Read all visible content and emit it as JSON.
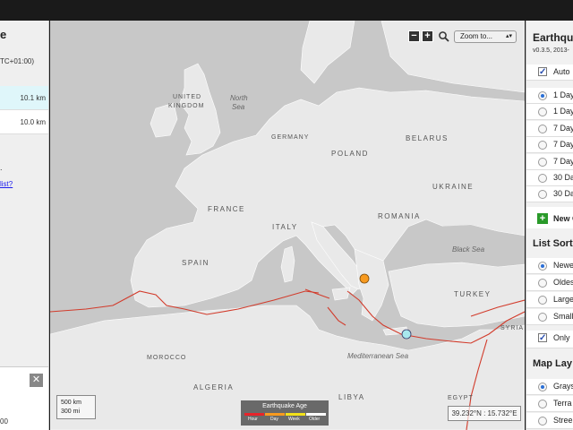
{
  "left_panel": {
    "title": "e",
    "utc": "TC+01:00)",
    "rows": [
      {
        "depth": "10.1 km"
      },
      {
        "depth": "10.0 km"
      }
    ],
    "dot": ".",
    "link": "list?",
    "close_icon": "close-icon",
    "bottom_value": "00"
  },
  "map": {
    "labels": {
      "uk": "UNITED",
      "kingdom": "KINGDOM",
      "north_sea": "North",
      "north_sea2": "Sea",
      "germany": "GERMANY",
      "poland": "POLAND",
      "belarus": "BELARUS",
      "ukraine": "UKRAINE",
      "france": "FRANCE",
      "italy": "ITALY",
      "romania": "ROMANIA",
      "black_sea": "Black Sea",
      "spain": "SPAIN",
      "turkey": "TURKEY",
      "syria": "SYRIA",
      "med_sea": "Mediterranean Sea",
      "morocco": "MOROCCO",
      "algeria": "ALGERIA",
      "libya": "LIBYA",
      "egypt": "EGYPT"
    },
    "zoom_minus": "−",
    "zoom_plus": "+",
    "search_icon": "magnifier-icon",
    "zoom_select": "Zoom to...",
    "scale_km": "500 km",
    "scale_mi": "300 mi",
    "legend": {
      "title": "Earthquake Age",
      "items": [
        "Hour",
        "Day",
        "Week",
        "Older"
      ],
      "colors": [
        "#e8232a",
        "#f79a1f",
        "#f2e11a",
        "#ffffff"
      ]
    },
    "coords": "39.232°N : 15.732°E",
    "events": [
      {
        "color": "#f79a1f",
        "age": "Day"
      },
      {
        "color": "#a8e8ee",
        "age": "Older"
      }
    ]
  },
  "right_panel": {
    "title": "Earthqu",
    "version": "v0.3.5, 2013-",
    "auto_label": "Auto",
    "time_options": [
      {
        "label": "1 Day",
        "selected": true
      },
      {
        "label": "1 Day",
        "selected": false
      },
      {
        "label": "7 Day",
        "selected": false
      },
      {
        "label": "7 Day",
        "selected": false
      },
      {
        "label": "7 Day",
        "selected": false
      },
      {
        "label": "30 Da",
        "selected": false
      },
      {
        "label": "30 Da",
        "selected": false
      }
    ],
    "new_label": "New C",
    "sort_heading": "List Sort",
    "sort_options": [
      {
        "label": "Newe",
        "selected": true
      },
      {
        "label": "Oldes",
        "selected": false
      },
      {
        "label": "Large",
        "selected": false
      },
      {
        "label": "Small",
        "selected": false
      }
    ],
    "only_label": "Only",
    "layers_heading": "Map Lay",
    "layer_options": [
      {
        "label": "Grays",
        "selected": true
      },
      {
        "label": "Terra",
        "selected": false
      },
      {
        "label": "Stree",
        "selected": false
      }
    ]
  }
}
